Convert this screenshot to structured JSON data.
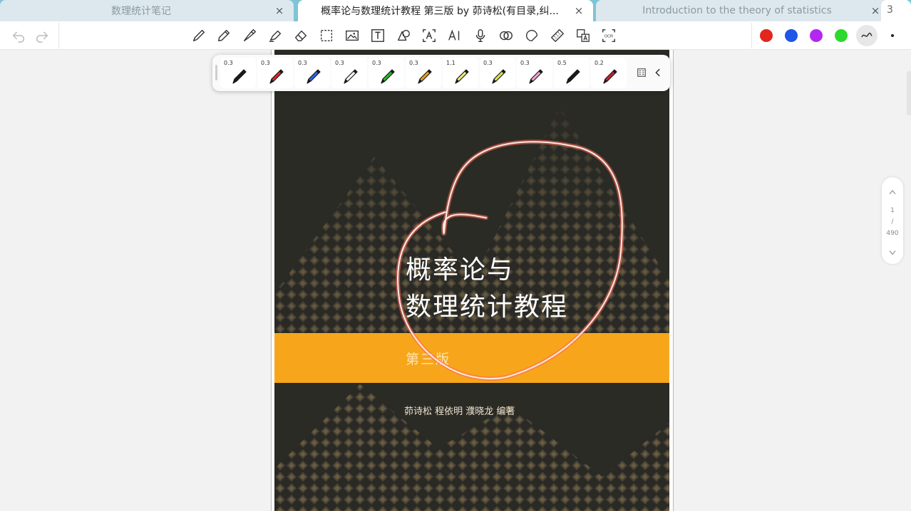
{
  "tabs": [
    {
      "label": "数理统计笔记",
      "close": "×",
      "active": false
    },
    {
      "label": "概率论与数理统计教程 第三版 by 茆诗松(有目录,纠...",
      "close": "×",
      "active": true
    },
    {
      "label": "Introduction to the theory of statistics",
      "close": "×",
      "active": false
    }
  ],
  "tab_count": "3",
  "toolbar": {
    "icons": [
      "undo-icon",
      "redo-icon",
      "pen-icon",
      "pencil-icon",
      "fountain-pen-icon",
      "highlighter-icon",
      "eraser-icon",
      "lasso-select-icon",
      "image-icon",
      "text-box-icon",
      "shapes-icon",
      "text-recognition-icon",
      "ai-icon",
      "microphone-icon",
      "record-icon",
      "sticky-shape-icon",
      "tape-icon",
      "translate-icon",
      "ocr-icon"
    ],
    "ocr_label": "OCR",
    "colors": [
      "#e3261c",
      "#1f56e6",
      "#b228f0",
      "#2fd82e"
    ]
  },
  "pen_presets": [
    {
      "size": "0.3",
      "color": "#1a1a1a"
    },
    {
      "size": "0.3",
      "color": "#d32a2a"
    },
    {
      "size": "0.3",
      "color": "#2f63d8"
    },
    {
      "size": "0.3",
      "color": "#ffffff"
    },
    {
      "size": "0.3",
      "color": "#2bb32b"
    },
    {
      "size": "0.3",
      "color": "#e9a21d"
    },
    {
      "size": "1.1",
      "color": "#f0ec7a"
    },
    {
      "size": "0.3",
      "color": "#dfe64b"
    },
    {
      "size": "0.3",
      "color": "#f2a6d8"
    },
    {
      "size": "0.5",
      "color": "#1a1a1a"
    },
    {
      "size": "0.2",
      "color": "#c8242c"
    }
  ],
  "document": {
    "title_line1": "概率论与",
    "title_line2": "数理统计教程",
    "edition": "第三版",
    "authors": "茆诗松  程依明  濮晓龙  编著",
    "cover_band_color": "#f7a61b",
    "annotation_color": "#e83a2a"
  },
  "page_indicator": {
    "current": "1",
    "separator": "/",
    "total": "490"
  }
}
